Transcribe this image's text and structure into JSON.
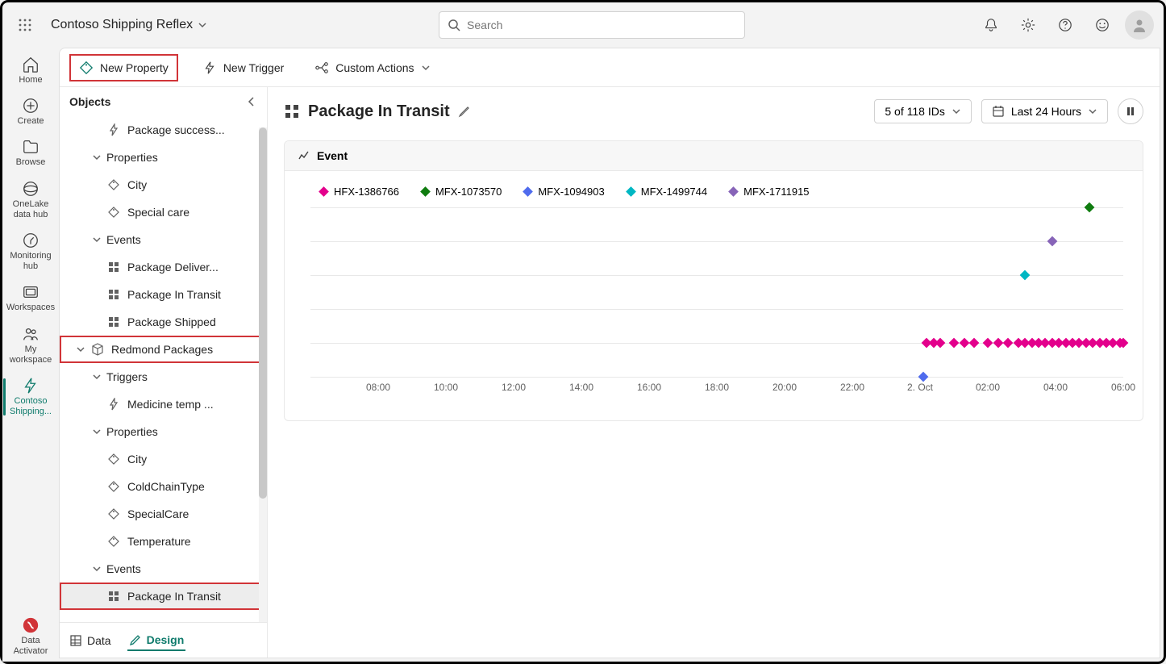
{
  "app": {
    "title": "Contoso Shipping Reflex"
  },
  "search": {
    "placeholder": "Search"
  },
  "leftrail": {
    "home": "Home",
    "create": "Create",
    "browse": "Browse",
    "onelake": "OneLake data hub",
    "monitoring": "Monitoring hub",
    "workspaces": "Workspaces",
    "myworkspace": "My workspace",
    "active": "Contoso Shipping...",
    "bottom": "Data Activator"
  },
  "toolbar": {
    "new_property": "New Property",
    "new_trigger": "New Trigger",
    "custom_actions": "Custom Actions"
  },
  "sidebar": {
    "title": "Objects",
    "items": [
      {
        "label": "Package success...",
        "icon": "bolt",
        "indent": 2
      },
      {
        "label": "Properties",
        "icon": "chev",
        "indent": 1
      },
      {
        "label": "City",
        "icon": "tag",
        "indent": 2
      },
      {
        "label": "Special care",
        "icon": "tag",
        "indent": 2
      },
      {
        "label": "Events",
        "icon": "chev",
        "indent": 1
      },
      {
        "label": "Package Deliver...",
        "icon": "grid",
        "indent": 2
      },
      {
        "label": "Package In Transit",
        "icon": "grid",
        "indent": 2
      },
      {
        "label": "Package Shipped",
        "icon": "grid",
        "indent": 2
      },
      {
        "label": "Redmond Packages",
        "icon": "cube",
        "indent": 0,
        "boxed": true
      },
      {
        "label": "Triggers",
        "icon": "chev",
        "indent": 1
      },
      {
        "label": "Medicine temp ...",
        "icon": "bolt",
        "indent": 2
      },
      {
        "label": "Properties",
        "icon": "chev",
        "indent": 1
      },
      {
        "label": "City",
        "icon": "tag",
        "indent": 2
      },
      {
        "label": "ColdChainType",
        "icon": "tag",
        "indent": 2
      },
      {
        "label": "SpecialCare",
        "icon": "tag",
        "indent": 2
      },
      {
        "label": "Temperature",
        "icon": "tag",
        "indent": 2
      },
      {
        "label": "Events",
        "icon": "chev",
        "indent": 1
      },
      {
        "label": "Package In Transit",
        "icon": "grid",
        "indent": 2,
        "boxed": true,
        "selected": true
      }
    ],
    "foot": {
      "data": "Data",
      "design": "Design"
    }
  },
  "content": {
    "title": "Package In Transit",
    "ids_label": "5 of 118 IDs",
    "time_label": "Last 24 Hours",
    "card_title": "Event"
  },
  "chart_data": {
    "type": "scatter",
    "title": "Event",
    "xlabel": "",
    "ylabel": "",
    "x_ticks": [
      "08:00",
      "10:00",
      "12:00",
      "14:00",
      "16:00",
      "18:00",
      "20:00",
      "22:00",
      "2. Oct",
      "02:00",
      "04:00",
      "06:00"
    ],
    "x_range_hours": [
      6,
      30
    ],
    "series": [
      {
        "name": "HFX-1386766",
        "color": "#e3008c",
        "y": 1,
        "x": [
          24.2,
          24.4,
          24.6,
          25.0,
          25.3,
          25.6,
          26.0,
          26.3,
          26.6,
          26.9,
          27.1,
          27.3,
          27.5,
          27.7,
          27.9,
          28.1,
          28.3,
          28.5,
          28.7,
          28.9,
          29.1,
          29.3,
          29.5,
          29.7,
          29.9,
          30.0
        ]
      },
      {
        "name": "MFX-1073570",
        "color": "#107c10",
        "y": 5,
        "x": [
          29.0
        ]
      },
      {
        "name": "MFX-1094903",
        "color": "#4f6bed",
        "y": 0,
        "x": [
          24.1
        ]
      },
      {
        "name": "MFX-1499744",
        "color": "#00b7c3",
        "y": 3,
        "x": [
          27.1
        ]
      },
      {
        "name": "MFX-1711915",
        "color": "#8764b8",
        "y": 4,
        "x": [
          27.9
        ]
      }
    ]
  }
}
